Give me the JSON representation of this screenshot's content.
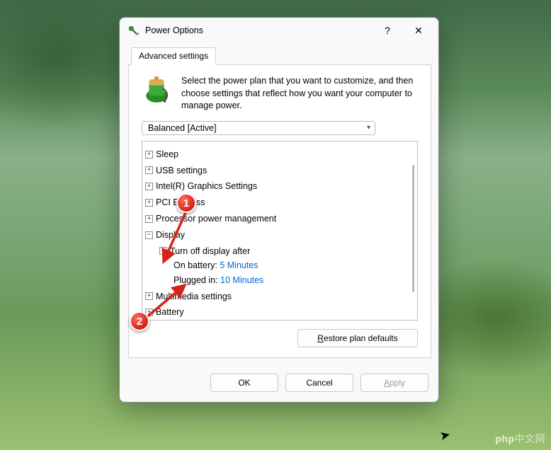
{
  "window": {
    "title": "Power Options",
    "help_label": "?",
    "close_label": "✕"
  },
  "tab": {
    "label": "Advanced settings"
  },
  "intro": {
    "text": "Select the power plan that you want to customize, and then choose settings that reflect how you want your computer to manage power."
  },
  "plan": {
    "selected": "Balanced [Active]"
  },
  "tree": {
    "items": [
      {
        "label": "Sleep",
        "state": "collapsed"
      },
      {
        "label": "USB settings",
        "state": "collapsed"
      },
      {
        "label": "Intel(R) Graphics Settings",
        "state": "collapsed"
      },
      {
        "label": "PCI Express",
        "state": "collapsed"
      },
      {
        "label": "Processor power management",
        "state": "collapsed"
      },
      {
        "label": "Display",
        "state": "expanded",
        "children": [
          {
            "label": "Turn off display after",
            "state": "expanded",
            "children": [
              {
                "label": "On battery:",
                "value": "5 Minutes"
              },
              {
                "label": "Plugged in:",
                "value": "10 Minutes"
              }
            ]
          }
        ]
      },
      {
        "label": "Multimedia settings",
        "state": "collapsed"
      },
      {
        "label": "Battery",
        "state": "collapsed"
      }
    ]
  },
  "buttons": {
    "restore": "Restore plan defaults",
    "ok": "OK",
    "cancel": "Cancel",
    "apply": "Apply"
  },
  "markers": {
    "one": "1",
    "two": "2"
  },
  "watermark": "php中文网"
}
